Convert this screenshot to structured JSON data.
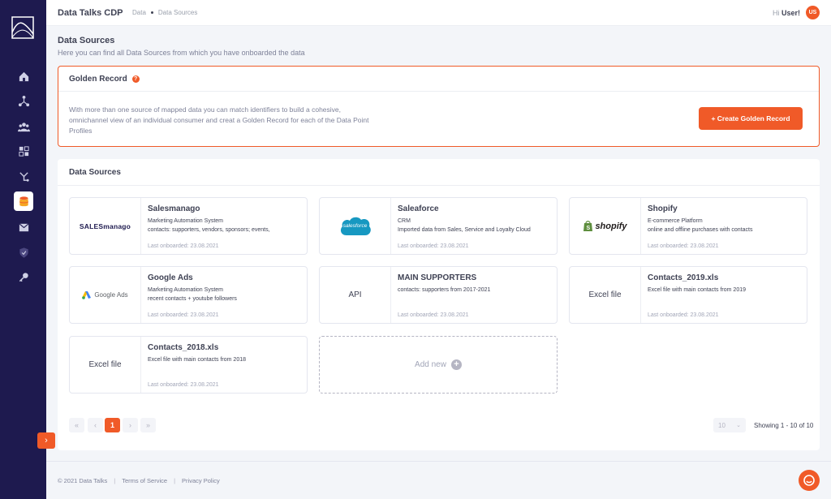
{
  "app": {
    "title": "Data Talks CDP"
  },
  "breadcrumb": [
    "Data",
    "Data Sources"
  ],
  "user": {
    "greeting": "Hi",
    "name": "User!",
    "initials": "US"
  },
  "page": {
    "title": "Data Sources",
    "subtitle": "Here you can find all Data Sources from which you have onboarded the data"
  },
  "golden_record": {
    "title": "Golden Record",
    "help": "?",
    "description": "With more than one source of mapped data you can match identifiers to build a cohesive, omnichannel view of an individual consumer and creat a Golden Record for each of the Data Point Profiles",
    "button_label": "+ Create Golden Record"
  },
  "sources": {
    "title": "Data Sources",
    "cards": [
      {
        "logo": "SALESmanago",
        "name": "Salesmanago",
        "type": "Marketing Automation System",
        "desc": "contacts: supporters, vendors, sponsors; events,",
        "date": "Last onboarded: 23.08.2021"
      },
      {
        "logo": "salesforce",
        "name": "Saleaforce",
        "type": "CRM",
        "desc": "Imported data from Sales, Service and Loyalty Cloud",
        "date": "Last onboarded: 23.08.2021"
      },
      {
        "logo": "shopify",
        "name": "Shopify",
        "type": "E-commerce Platform",
        "desc": "online and offline purchases with contacts",
        "date": "Last onboarded: 23.08.2021"
      },
      {
        "logo": "Google Ads",
        "name": "Google Ads",
        "type": "Marketing Automation System",
        "desc": "recent contacts + youtube followers",
        "date": "Last onboarded: 23.08.2021"
      },
      {
        "logo": "API",
        "name": "MAIN SUPPORTERS",
        "type": "contacts: supporters from 2017-2021",
        "desc": "",
        "date": "Last onboarded: 23.08.2021"
      },
      {
        "logo": "Excel file",
        "name": "Contacts_2019.xls",
        "type": "Excel file with main contacts from 2019",
        "desc": "",
        "date": "Last onboarded: 23.08.2021"
      },
      {
        "logo": "Excel file",
        "name": "Contacts_2018.xls",
        "type": "Excel file with main contacts from 2018",
        "desc": "",
        "date": "Last onboarded: 23.08.2021"
      }
    ],
    "add_new_label": "Add new"
  },
  "pagination": {
    "first": "«",
    "prev": "‹",
    "current": "1",
    "next": "›",
    "last": "»",
    "per_page": "10",
    "showing": "Showing 1 - 10 of 10"
  },
  "footer": {
    "copyright": "© 2021 Data Talks",
    "sep": "|",
    "terms": "Terms of Service",
    "privacy": "Privacy Policy"
  },
  "colors": {
    "accent": "#f05a28",
    "sidebar": "#1e1a4f",
    "salesforce": "#1798c1",
    "shopify": "#5e8e3e"
  }
}
